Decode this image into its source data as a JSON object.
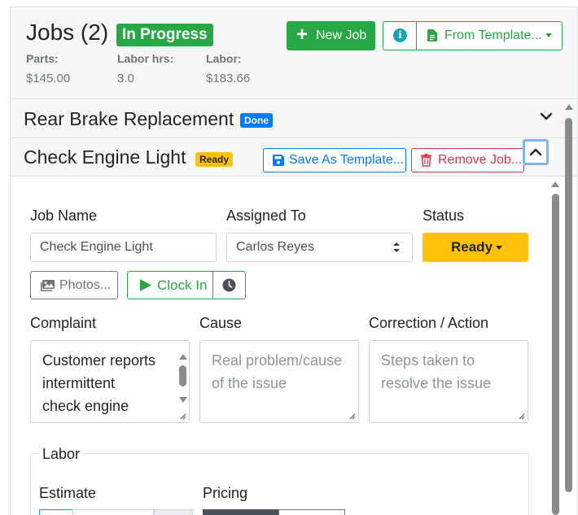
{
  "header": {
    "title": "Jobs (2)",
    "status_badge": "In Progress",
    "new_job_label": "New Job",
    "from_template_label": "From Template...",
    "stats": [
      {
        "label": "Parts:",
        "value": "$145.00"
      },
      {
        "label": "Labor hrs:",
        "value": "3.0"
      },
      {
        "label": "Labor:",
        "value": "$183.66"
      }
    ]
  },
  "jobs": [
    {
      "title": "Rear Brake Replacement",
      "badge": "Done",
      "badge_color": "#007bff"
    },
    {
      "title": "Check Engine Light",
      "badge": "Ready",
      "badge_color": "#ffc107"
    }
  ],
  "job_actions": {
    "save_template": "Save As Template...",
    "remove_job": "Remove Job..."
  },
  "form": {
    "job_name_label": "Job Name",
    "job_name_value": "Check Engine Light",
    "assigned_label": "Assigned To",
    "assigned_value": "Carlos Reyes",
    "status_label": "Status",
    "status_value": "Ready",
    "photos_label": "Photos...",
    "clock_in_label": "Clock In",
    "complaint_label": "Complaint",
    "complaint_lines": [
      "Customer reports",
      "intermittent",
      "check engine"
    ],
    "cause_label": "Cause",
    "cause_placeholder": [
      "Real problem/cause",
      "of the issue"
    ],
    "correction_label": "Correction / Action",
    "correction_placeholder": [
      "Steps taken to",
      "resolve the issue"
    ],
    "labor_legend": "Labor",
    "estimate_label": "Estimate",
    "pricing_label": "Pricing"
  },
  "colors": {
    "success": "#28a745",
    "primary": "#007bff",
    "danger": "#dc3545",
    "warning": "#ffc107",
    "info": "#17a2b8"
  },
  "icons": [
    "plus-icon",
    "info-icon",
    "file-icon",
    "chevron-down-icon",
    "save-icon",
    "trash-icon",
    "chevron-up-icon",
    "image-icon",
    "play-icon",
    "clock-icon"
  ]
}
